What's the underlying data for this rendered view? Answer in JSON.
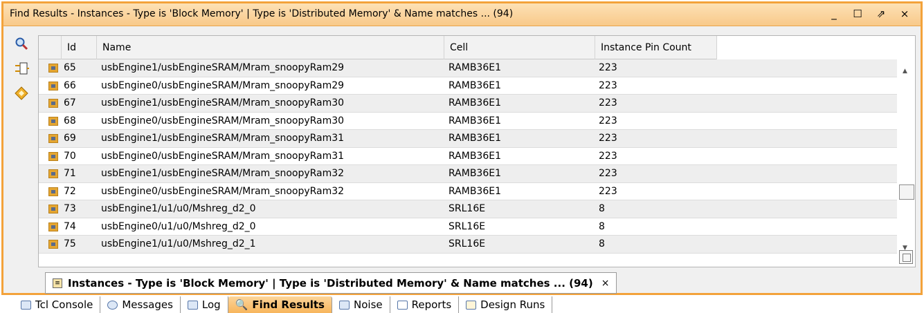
{
  "window": {
    "title": "Find Results - Instances - Type is 'Block Memory' | Type is 'Distributed Memory' & Name matches ... (94)",
    "controls": {
      "minimize": "_",
      "maximize": "☐",
      "float": "⇗",
      "close": "×"
    }
  },
  "toolbar": [
    {
      "name": "search-icon",
      "glyph": "🔍"
    },
    {
      "name": "schematic-icon",
      "glyph": "⊐"
    },
    {
      "name": "properties-icon",
      "glyph": "◈"
    }
  ],
  "table": {
    "columns": {
      "id": "Id",
      "name": "Name",
      "cell": "Cell",
      "pin_count": "Instance Pin Count"
    },
    "rows": [
      {
        "id": "65",
        "name": "usbEngine1/usbEngineSRAM/Mram_snoopyRam29",
        "cell": "RAMB36E1",
        "pins": "223"
      },
      {
        "id": "66",
        "name": "usbEngine0/usbEngineSRAM/Mram_snoopyRam29",
        "cell": "RAMB36E1",
        "pins": "223"
      },
      {
        "id": "67",
        "name": "usbEngine1/usbEngineSRAM/Mram_snoopyRam30",
        "cell": "RAMB36E1",
        "pins": "223"
      },
      {
        "id": "68",
        "name": "usbEngine0/usbEngineSRAM/Mram_snoopyRam30",
        "cell": "RAMB36E1",
        "pins": "223"
      },
      {
        "id": "69",
        "name": "usbEngine1/usbEngineSRAM/Mram_snoopyRam31",
        "cell": "RAMB36E1",
        "pins": "223"
      },
      {
        "id": "70",
        "name": "usbEngine0/usbEngineSRAM/Mram_snoopyRam31",
        "cell": "RAMB36E1",
        "pins": "223"
      },
      {
        "id": "71",
        "name": "usbEngine1/usbEngineSRAM/Mram_snoopyRam32",
        "cell": "RAMB36E1",
        "pins": "223"
      },
      {
        "id": "72",
        "name": "usbEngine0/usbEngineSRAM/Mram_snoopyRam32",
        "cell": "RAMB36E1",
        "pins": "223"
      },
      {
        "id": "73",
        "name": "usbEngine1/u1/u0/Mshreg_d2_0",
        "cell": "SRL16E",
        "pins": "8"
      },
      {
        "id": "74",
        "name": "usbEngine0/u1/u0/Mshreg_d2_0",
        "cell": "SRL16E",
        "pins": "8"
      },
      {
        "id": "75",
        "name": "usbEngine1/u1/u0/Mshreg_d2_1",
        "cell": "SRL16E",
        "pins": "8"
      }
    ]
  },
  "result_tab": {
    "label": "Instances - Type is 'Block Memory' | Type is 'Distributed Memory' & Name matches ... (94)",
    "close": "×"
  },
  "bottom_tabs": [
    {
      "label": "Tcl Console",
      "icon": "console-icon",
      "active": false
    },
    {
      "label": "Messages",
      "icon": "messages-icon",
      "active": false
    },
    {
      "label": "Log",
      "icon": "log-icon",
      "active": false
    },
    {
      "label": "Find Results",
      "icon": "find-results-icon",
      "active": true
    },
    {
      "label": "Noise",
      "icon": "noise-icon",
      "active": false
    },
    {
      "label": "Reports",
      "icon": "reports-icon",
      "active": false
    },
    {
      "label": "Design Runs",
      "icon": "design-runs-icon",
      "active": false
    }
  ],
  "colors": {
    "accent": "#f3a23a",
    "titlebar": "#f8c98a",
    "active_tab": "#f7b55c"
  }
}
